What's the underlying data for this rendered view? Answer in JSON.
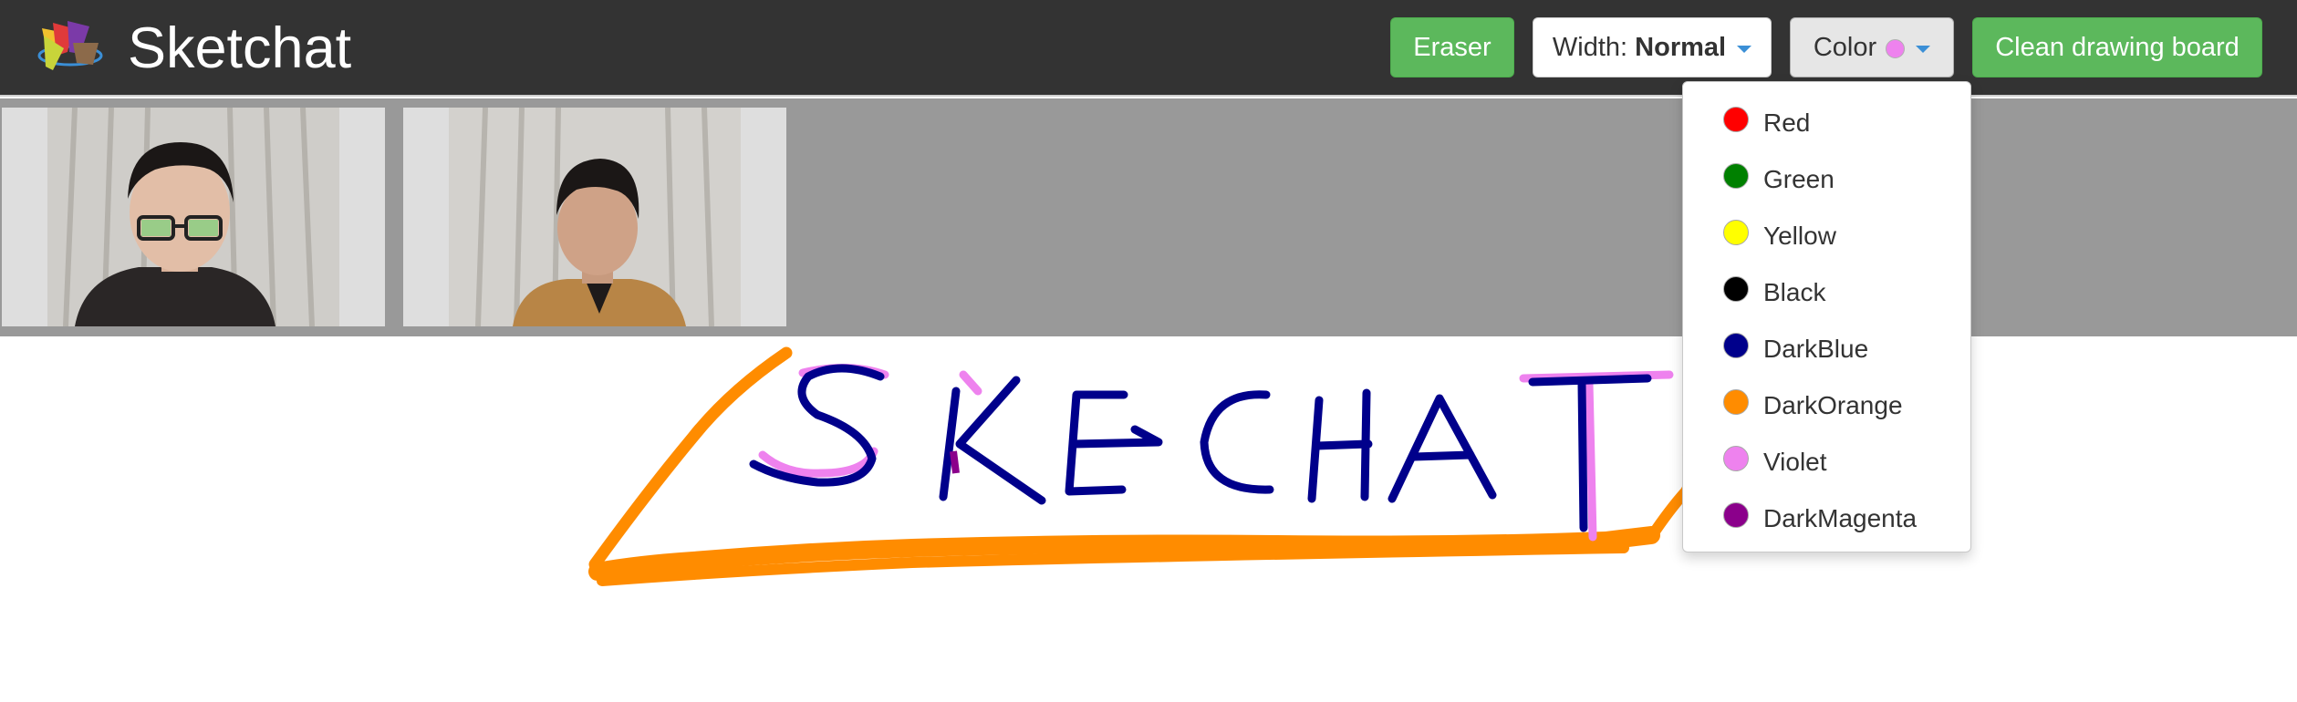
{
  "app": {
    "title": "Sketchat"
  },
  "toolbar": {
    "eraser_label": "Eraser",
    "width_prefix": "Width: ",
    "width_value": "Normal",
    "color_label": "Color",
    "color_current": "#ee82ee",
    "clean_label": "Clean drawing board"
  },
  "color_menu": {
    "items": [
      {
        "label": "Red",
        "color": "#ff0000"
      },
      {
        "label": "Green",
        "color": "#008000"
      },
      {
        "label": "Yellow",
        "color": "#ffff00"
      },
      {
        "label": "Black",
        "color": "#000000"
      },
      {
        "label": "DarkBlue",
        "color": "#00008b"
      },
      {
        "label": "DarkOrange",
        "color": "#ff8c00"
      },
      {
        "label": "Violet",
        "color": "#ee82ee"
      },
      {
        "label": "DarkMagenta",
        "color": "#8b008b"
      }
    ]
  },
  "videos": [
    {
      "name": "participant-1"
    },
    {
      "name": "participant-2"
    }
  ],
  "colors": {
    "navbar": "#333333",
    "button_green": "#5cb85c",
    "video_strip": "#999999",
    "stroke_orange": "#ff8c00",
    "stroke_blue": "#00008b",
    "stroke_violet": "#ee82ee"
  },
  "drawing": {
    "text": "SKECHAT"
  }
}
